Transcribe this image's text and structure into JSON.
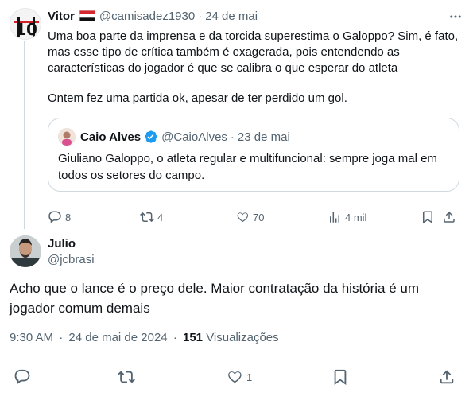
{
  "parent_tweet": {
    "name": "Vitor",
    "handle": "@camisadez1930",
    "separator": "·",
    "date": "24 de mai",
    "text_p1": "Uma boa parte da imprensa e da torcida superestima o Galoppo? Sim, é fato, mas esse tipo de crítica também é exagerada, pois entendendo as características do jogador é que se calibra o que esperar do atleta",
    "text_p2": "Ontem fez uma partida ok, apesar de ter perdido um gol.",
    "quote": {
      "name": "Caio Alves",
      "handle": "@CaioAlves",
      "separator": "·",
      "date": "23 de mai",
      "text": "Giuliano Galoppo, o atleta regular e multifuncional: sempre joga mal em todos os setores do campo."
    },
    "actions": {
      "replies": "8",
      "reposts": "4",
      "likes": "70",
      "views": "4 mil"
    }
  },
  "main_tweet": {
    "name": "Julio",
    "handle": "@jcbrasi",
    "text": "Acho que o lance é o preço dele. Maior contratação da história é um jogador comum demais",
    "time": "9:30 AM",
    "separator": "·",
    "date": "24 de mai de 2024",
    "separator2": "·",
    "views_count": "151",
    "views_label": "Visualizações",
    "actions": {
      "likes": "1"
    }
  },
  "colors": {
    "text": "#0f1419",
    "muted": "#536471",
    "border": "#cfd9de",
    "verified": "#1d9bf0"
  },
  "icons": [
    "more-icon",
    "flag-icon",
    "verified-icon",
    "reply-icon",
    "repost-icon",
    "like-icon",
    "views-icon",
    "bookmark-icon",
    "share-icon"
  ]
}
